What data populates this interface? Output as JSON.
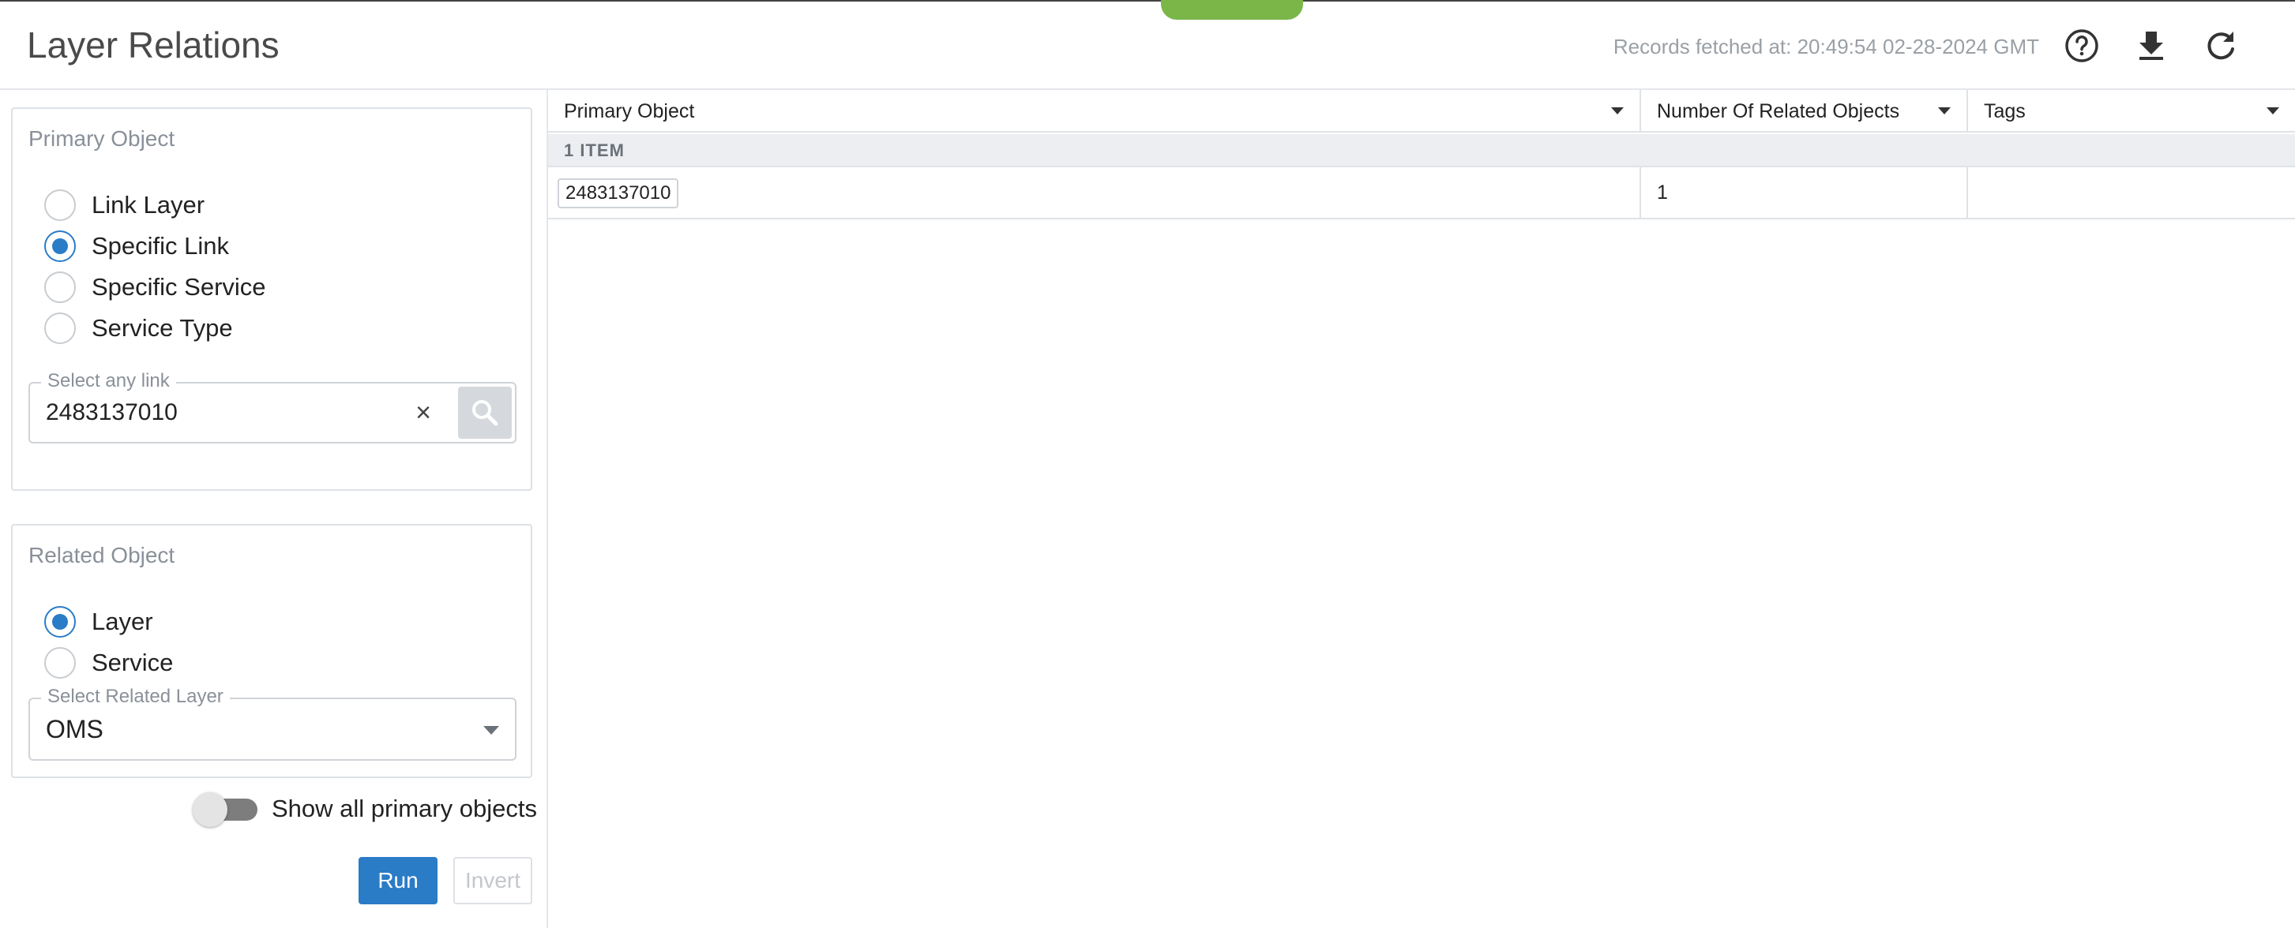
{
  "header": {
    "title": "Layer Relations",
    "records_fetched": "Records fetched at: 20:49:54 02-28-2024 GMT",
    "help_icon": "help-circle-icon",
    "download_icon": "download-icon",
    "refresh_icon": "refresh-icon"
  },
  "primary_object": {
    "title": "Primary Object",
    "options": [
      "Link Layer",
      "Specific Link",
      "Specific Service",
      "Service Type"
    ],
    "selected": "Specific Link",
    "link_field": {
      "legend": "Select any link",
      "value": "2483137010",
      "clear_icon": "close-icon",
      "search_icon": "search-icon"
    }
  },
  "related_object": {
    "title": "Related Object",
    "options": [
      "Layer",
      "Service"
    ],
    "selected": "Layer",
    "layer_field": {
      "legend": "Select Related Layer",
      "value": "OMS"
    }
  },
  "toggle": {
    "label": "Show all primary objects",
    "on": false
  },
  "actions": {
    "run_label": "Run",
    "invert_label": "Invert"
  },
  "grid": {
    "columns": [
      "Primary Object",
      "Number Of Related Objects",
      "Tags"
    ],
    "group_label": "1 ITEM",
    "rows": [
      {
        "primary_object": "2483137010",
        "related_count": "1",
        "tags": ""
      }
    ]
  },
  "colors": {
    "accent": "#2a7cc7",
    "tab_green": "#7ab648",
    "header_text": "#4a4a4a"
  }
}
